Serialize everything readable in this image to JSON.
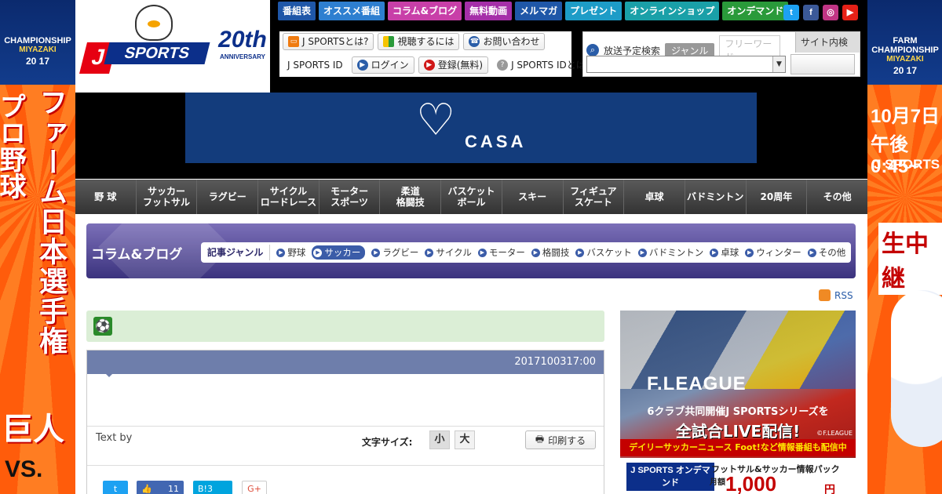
{
  "left_banner": {
    "event": "CHAMPIONSHIP",
    "place": "MIYAZAKI",
    "year": "20 17",
    "title_line1": "プロ野球",
    "title_line2": "ファーム日本選手権",
    "team1": "巨人",
    "vs": "VS."
  },
  "right_banner": {
    "event": "FARM CHAMPIONSHIP",
    "place": "MIYAZAKI",
    "year": "20 17",
    "date": "10月7日",
    "time": "午後0:45~",
    "channel": "J SPORTS",
    "live": "生中継"
  },
  "header": {
    "logo_text": "SPORTS",
    "logo_letter": "J",
    "anniversary_number": "20th",
    "anniversary_label": "ANNIVERSARY",
    "top_nav": [
      {
        "label": "番組表",
        "color": "#1f57a8"
      },
      {
        "label": "オススメ番組",
        "color": "#2e7fd0"
      },
      {
        "label": "コラム&ブログ",
        "color": "#c83fa8"
      },
      {
        "label": "無料動画",
        "color": "#a52fa8"
      },
      {
        "label": "メルマガ",
        "color": "#1f57a8"
      },
      {
        "label": "プレゼント",
        "color": "#1d9cc7"
      },
      {
        "label": "オンラインショップ",
        "color": "#1aa0a8"
      },
      {
        "label": "オンデマンド",
        "color": "#2a9a3a"
      }
    ],
    "social": [
      {
        "name": "twitter-icon",
        "glyph": "t",
        "color": "#1da1f2"
      },
      {
        "name": "facebook-icon",
        "glyph": "f",
        "color": "#3b5998"
      },
      {
        "name": "instagram-icon",
        "glyph": "◎",
        "color": "#c13584"
      },
      {
        "name": "youtube-icon",
        "glyph": "▶",
        "color": "#e62117"
      }
    ],
    "info_links": {
      "about": "J SPORTSとは?",
      "howto": "視聴するには",
      "contact": "お問い合わせ",
      "id_label": "J SPORTS ID",
      "login": "ログイン",
      "register": "登録(無料)",
      "id_about": "J SPORTS IDとは"
    },
    "search": {
      "schedule_label": "放送予定検索",
      "genre_button": "ジャンル",
      "freeword_placeholder": "フリーワード",
      "site_search": "サイト内検索"
    }
  },
  "banner_ad": {
    "brand": "CASA"
  },
  "category_nav": [
    "野 球",
    "サッカー\nフットサル",
    "ラグビー",
    "サイクル\nロードレース",
    "モーター\nスポーツ",
    "柔道\n格闘技",
    "バスケット\nボール",
    "スキー",
    "フィギュア\nスケート",
    "卓球",
    "バドミントン",
    "20周年",
    "その他"
  ],
  "column_bar": {
    "title": "コラム&ブログ",
    "genre_label": "記事ジャンル",
    "genres": [
      "野球",
      "サッカー",
      "ラグビー",
      "サイクル",
      "モーター",
      "格闘技",
      "バスケット",
      "バドミントン",
      "卓球",
      "ウィンター",
      "その他"
    ],
    "active_genre": "サッカー"
  },
  "rss_label": "RSS",
  "article": {
    "date_id": "2017100317:00",
    "text_by": "Text by",
    "font_size_label": "文字サイズ:",
    "font_small": "小",
    "font_large": "大",
    "print_label": "印刷する",
    "share": {
      "like_count": "11",
      "hatena": "B!3",
      "gplus": "G+"
    }
  },
  "side_ad": {
    "league": "F.LEAGUE",
    "line1": "6クラブ共同開催J SPORTSシリーズを",
    "line2": "全試合LIVE配信!",
    "copyright": "©F.LEAGUE",
    "line3": "デイリーサッカーニュース Foot!など情報番組も配信中",
    "logo": "J SPORTS オンデマンド",
    "pack": "フットサル&サッカー情報パック",
    "per_month": "月額",
    "price": "1,000",
    "currency": "円"
  }
}
